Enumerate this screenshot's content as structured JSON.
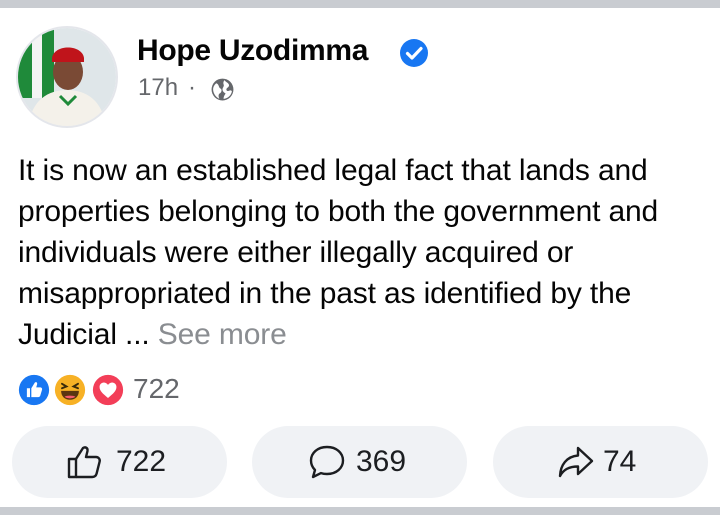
{
  "post": {
    "author": "Hope Uzodimma",
    "time": "17h",
    "separator": "·",
    "audience_icon": "globe-icon",
    "text": "It is now an established legal fact that lands and properties belonging to both the government and individuals were either illegally acquired or misappropriated in the past as identified by the Judicial ...",
    "see_more": "See more"
  },
  "reactions": {
    "icons": [
      "like-icon",
      "haha-icon",
      "love-icon"
    ],
    "total": "722"
  },
  "actions": {
    "like_count": "722",
    "comment_count": "369",
    "share_count": "74"
  },
  "colors": {
    "brand_blue": "#1877f2",
    "love_red": "#f33e58",
    "haha_yellow": "#f7b125",
    "button_bg": "#f0f2f5",
    "secondary_text": "#65676b"
  }
}
